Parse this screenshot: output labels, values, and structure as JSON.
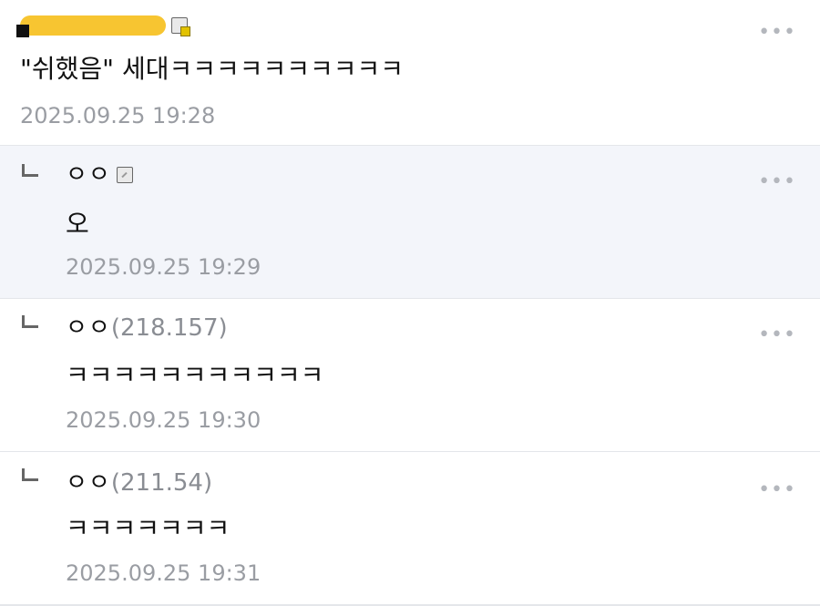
{
  "comments": [
    {
      "nick": "",
      "text": "\"쉬했음\" 세대ㅋㅋㅋㅋㅋㅋㅋㅋㅋㅋ",
      "time": "2025.09.25 19:28",
      "more": "•••"
    }
  ],
  "replies": [
    {
      "nick": "ㅇㅇ",
      "ip": "",
      "text": "오",
      "time": "2025.09.25 19:29",
      "more": "•••"
    },
    {
      "nick": "ㅇㅇ",
      "ip": "(218.157)",
      "text": "ㅋㅋㅋㅋㅋㅋㅋㅋㅋㅋㅋ",
      "time": "2025.09.25 19:30",
      "more": "•••"
    },
    {
      "nick": "ㅇㅇ",
      "ip": "(211.54)",
      "text": "ㅋㅋㅋㅋㅋㅋㅋ",
      "time": "2025.09.25 19:31",
      "more": "•••"
    }
  ]
}
